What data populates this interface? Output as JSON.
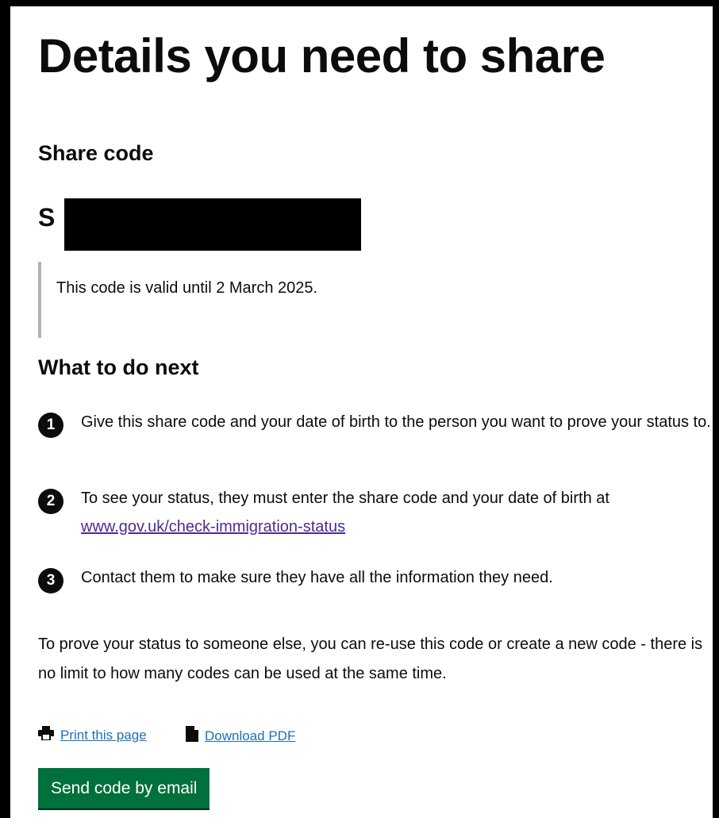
{
  "page": {
    "title": "Details you need to share"
  },
  "share_code": {
    "heading": "Share code",
    "visible_prefix": "S",
    "validity": "This code is valid until 2 March 2025."
  },
  "next_steps": {
    "heading": "What to do next",
    "steps": [
      {
        "number": "1",
        "text": "Give this share code and your date of birth to the person you want to prove your status to."
      },
      {
        "number": "2",
        "text_before_link": "To see your status, they must enter the share code and your date of birth at",
        "link_text": "www.gov.uk/check-immigration-status"
      },
      {
        "number": "3",
        "text": "Contact them to make sure they have all the information they need."
      }
    ]
  },
  "reuse_note": "To prove your status to someone else, you can re-use this code or create a new code - there is no limit to how many codes can be used at the same time.",
  "actions": {
    "print_label": "Print this page",
    "download_label": "Download PDF",
    "send_button_label": "Send code by email"
  },
  "colors": {
    "text": "#0b0c0c",
    "link": "#1d70b8",
    "visited_link": "#4c2c92",
    "button": "#00703c",
    "inset_border": "#b1b4b6"
  },
  "icons": {
    "print": "printer-icon",
    "download": "document-icon"
  }
}
